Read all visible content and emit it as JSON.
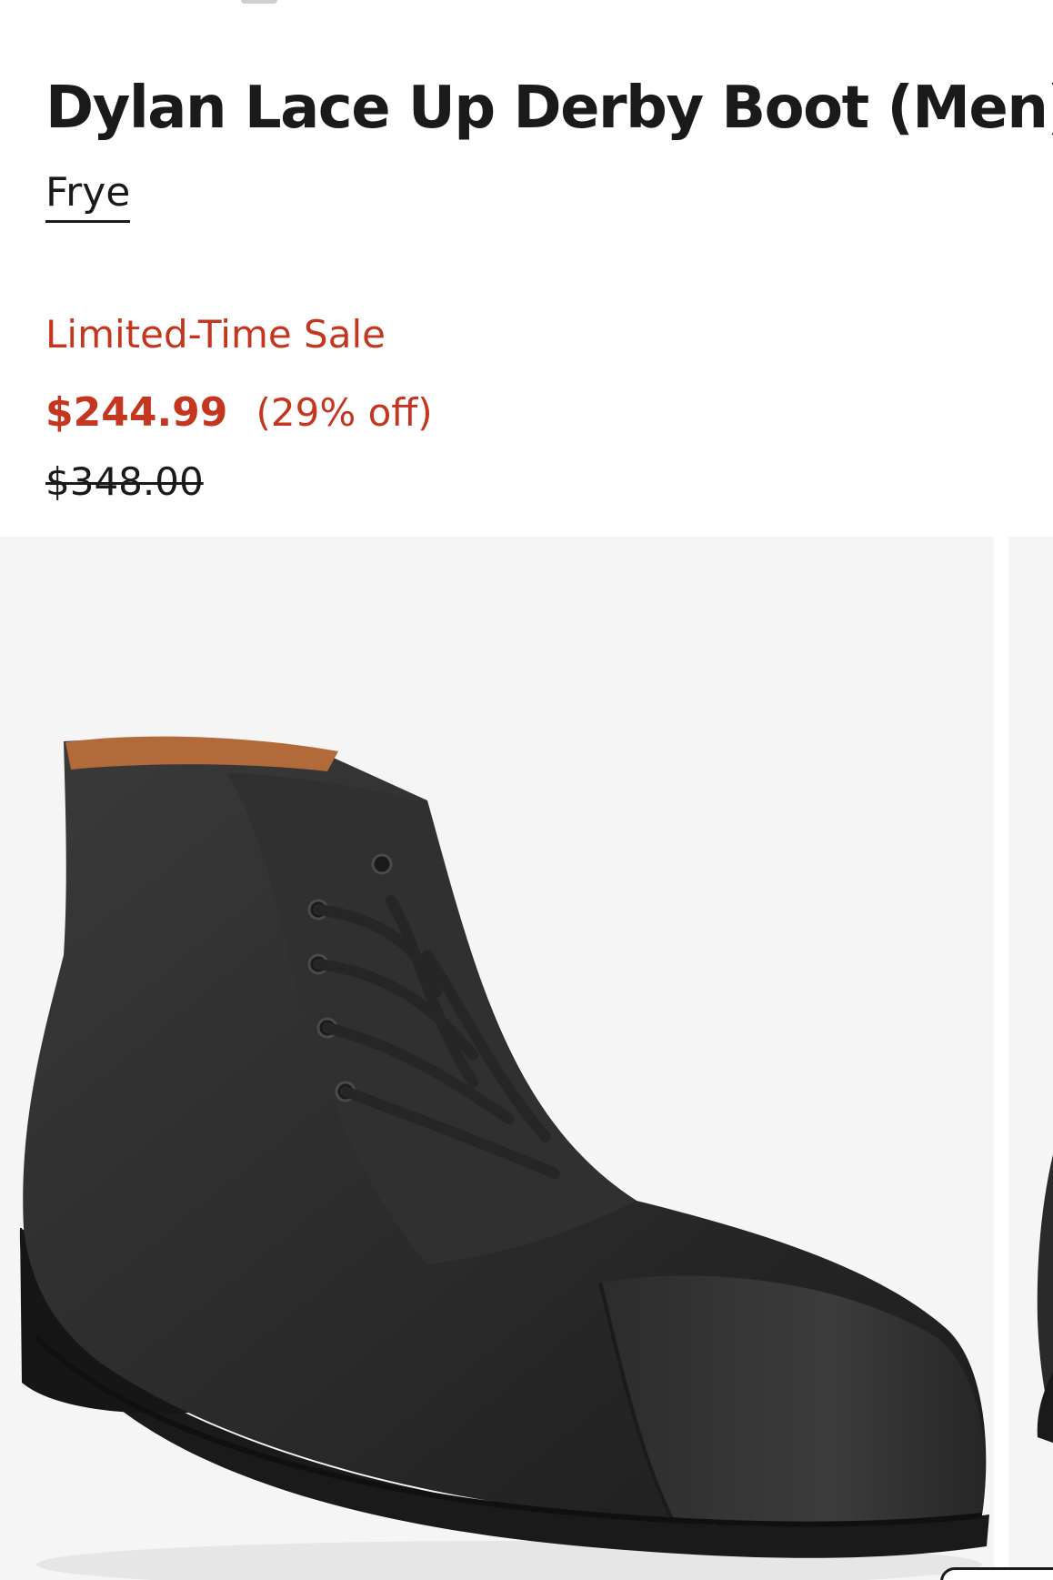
{
  "product": {
    "title": "Dylan Lace Up Derby Boot (Men)",
    "brand": "Frye"
  },
  "pricing": {
    "sale_label": "Limited-Time Sale",
    "sale_price": "$244.99",
    "discount": "(29% off)",
    "original_price": "$348.00"
  },
  "colors": {
    "sale_red": "#c4361f",
    "text": "#1a1a1a",
    "image_background": "#f5f5f5",
    "boot_leather": "#2e2e2e",
    "boot_lining": "#b26a3a"
  },
  "gallery": {
    "images": [
      {
        "subject": "black leather lace-up derby boot, three-quarter side view"
      },
      {
        "subject": "partial view of next product image"
      }
    ]
  }
}
